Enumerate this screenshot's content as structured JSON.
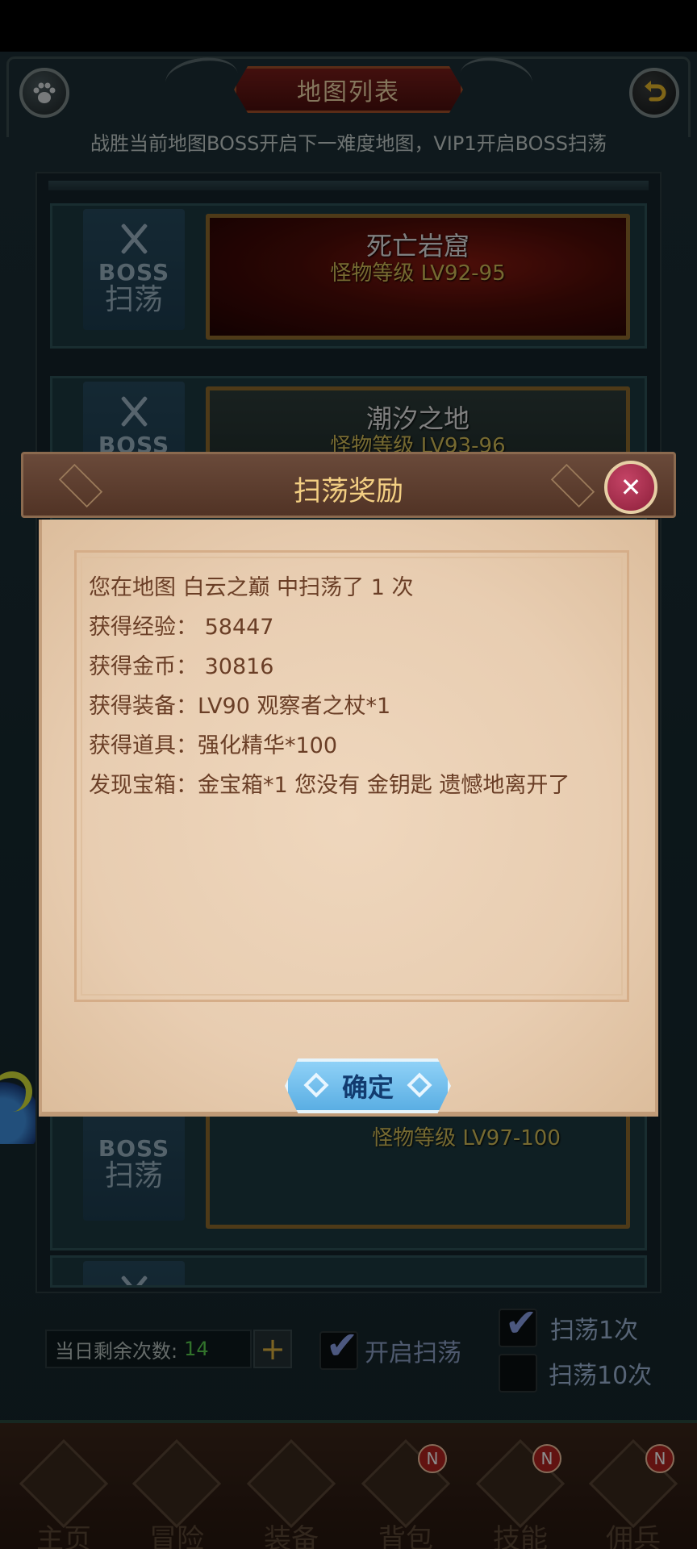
{
  "header": {
    "title": "地图列表",
    "subtitle": "战胜当前地图BOSS开启下一难度地图，VIP1开启BOSS扫荡"
  },
  "maps": [
    {
      "badge_word": "BOSS",
      "badge_action": "扫荡",
      "name": "死亡岩窟",
      "level": "怪物等级 LV92-95"
    },
    {
      "badge_word": "BOSS",
      "badge_action": "",
      "name": "潮汐之地",
      "level": "怪物等级 LV93-96"
    },
    {
      "badge_word": "BOSS",
      "badge_action": "扫荡",
      "name": "",
      "level": "怪物等级 LV97-100"
    }
  ],
  "controls": {
    "remaining_label": "当日剩余次数:",
    "remaining_count": "14",
    "plus_label": "+",
    "enable_sweep_label": "开启扫荡",
    "sweep_once_label": "扫荡1次",
    "sweep_ten_label": "扫荡10次",
    "enable_sweep_checked": true,
    "sweep_once_checked": true,
    "sweep_ten_checked": false
  },
  "nav": [
    {
      "label": "主页",
      "badge": ""
    },
    {
      "label": "冒险",
      "badge": ""
    },
    {
      "label": "装备",
      "badge": ""
    },
    {
      "label": "背包",
      "badge": "N"
    },
    {
      "label": "技能",
      "badge": "N"
    },
    {
      "label": "佣兵",
      "badge": "N"
    }
  ],
  "dialog": {
    "title": "扫荡奖励",
    "close_icon": "close-icon",
    "lines": [
      "您在地图 白云之巅 中扫荡了 1 次",
      "获得经验： 58447",
      "获得金币： 30816",
      "获得装备：LV90 观察者之杖*1",
      "获得道具：强化精华*100",
      "发现宝箱：金宝箱*1 您没有 金钥匙 遗憾地离开了"
    ],
    "confirm_label": "确定"
  },
  "colors": {
    "background": "#172a31",
    "dialog_paper": "#ead0b4",
    "dialog_header": "#5c3d2e",
    "reward_text": "#6a3e26",
    "confirm_button": "#6cbdf0",
    "close_button": "#a83250",
    "remaining_count": "#59d04f"
  }
}
